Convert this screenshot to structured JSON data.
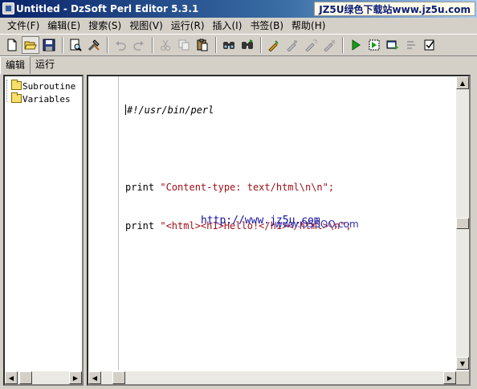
{
  "window": {
    "title": "Untitled - DzSoft Perl Editor 5.3.1",
    "watermark": "JZ5U绿色下载站www.jz5u.com"
  },
  "menu": [
    {
      "label": "文件(F)"
    },
    {
      "label": "编辑(E)"
    },
    {
      "label": "搜索(S)"
    },
    {
      "label": "视图(V)"
    },
    {
      "label": "运行(R)"
    },
    {
      "label": "插入(I)"
    },
    {
      "label": "书签(B)"
    },
    {
      "label": "帮助(H)"
    }
  ],
  "toolbar": {
    "buttons": [
      "new-file-icon",
      "open-folder-icon",
      "save-icon",
      "preview-icon",
      "tools-icon",
      "undo-icon",
      "redo-icon",
      "cut-icon",
      "copy-icon",
      "paste-icon",
      "find-icon",
      "find-next-icon",
      "syntax-check-icon",
      "debug-icon",
      "debug-step-icon",
      "debug-stop-icon",
      "run-icon",
      "run-dos-icon",
      "run-browser-icon",
      "settings-icon",
      "checklist-icon"
    ]
  },
  "tabs": {
    "edit": "编辑",
    "run": "运行"
  },
  "tree": {
    "items": [
      {
        "label": "Subroutine"
      },
      {
        "label": "Variables"
      }
    ]
  },
  "editor": {
    "lines": [
      {
        "text": "#!/usr/bin/perl"
      },
      {
        "text": ""
      },
      {
        "kw": "print ",
        "str": "\"Content-type: text/html\\n\\n\";"
      },
      {
        "kw": "print ",
        "str": "\"<html><h1>Hello!</h1></html>\\n\";"
      }
    ]
  },
  "watermark_overlay": {
    "url": "http://www.jz5u.com",
    "overlay": "www.OSSOO.com"
  }
}
